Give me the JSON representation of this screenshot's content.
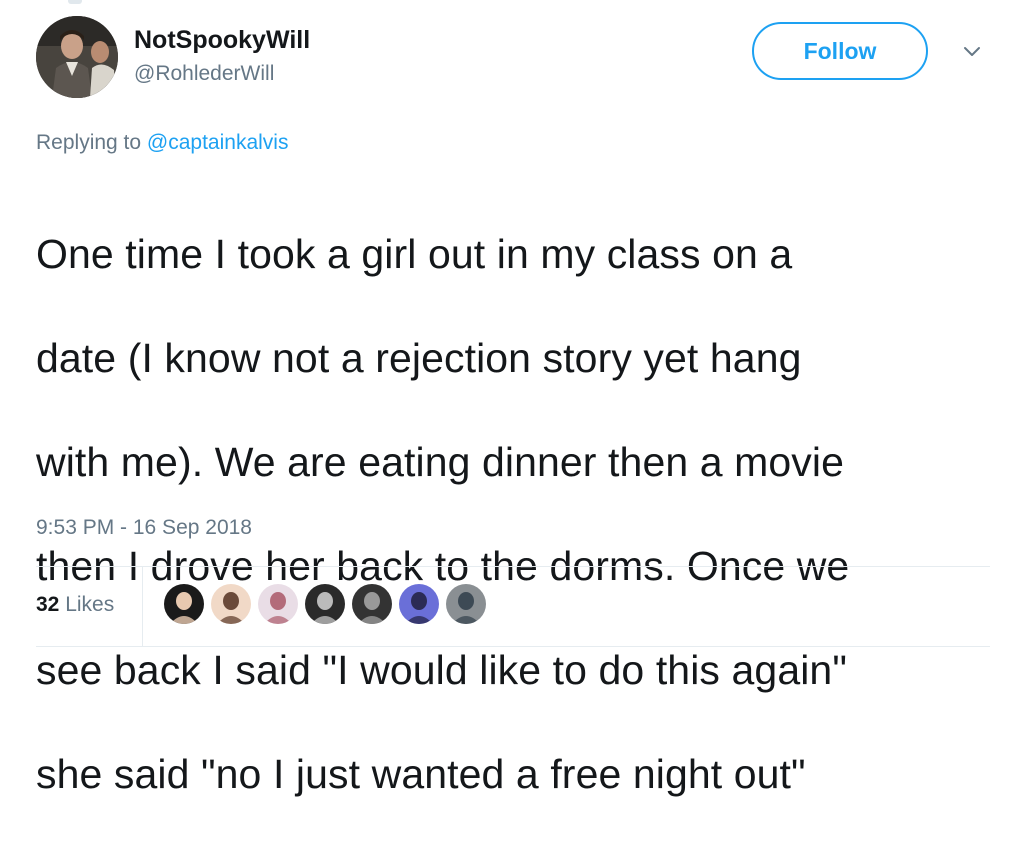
{
  "tweet": {
    "display_name": "NotSpookyWill",
    "handle": "@RohlederWill",
    "follow_label": "Follow",
    "replying_prefix": "Replying to",
    "replying_to": "@captainkalvis",
    "text_lines": [
      "One time I took a girl out in my class on a",
      "date (I know not a rejection story yet hang",
      "with me). We are eating dinner then a movie",
      "then I drove her back to the dorms. Once we",
      "see back I said \"I would like to do this again\"",
      "she said \"no I just wanted a free night out\""
    ],
    "timestamp": "9:53 PM - 16 Sep 2018",
    "likes_count": "32",
    "likes_label": "Likes"
  },
  "colors": {
    "accent": "#1da1f2",
    "secondary_text": "#657786",
    "primary_text": "#14171a",
    "divider": "#e6ecf0"
  },
  "icons": {
    "menu": "chevron-down-icon"
  },
  "likers": [
    {
      "name": "liker-avatar-1",
      "bg": "#1a1a1a",
      "fg": "#e8c9b0"
    },
    {
      "name": "liker-avatar-2",
      "bg": "#f1d9c7",
      "fg": "#6b4a3a"
    },
    {
      "name": "liker-avatar-3",
      "bg": "#e9dde6",
      "fg": "#b36b7a"
    },
    {
      "name": "liker-avatar-4",
      "bg": "#2a2a2a",
      "fg": "#bbbbbb"
    },
    {
      "name": "liker-avatar-5",
      "bg": "#333333",
      "fg": "#999999"
    },
    {
      "name": "liker-avatar-6",
      "bg": "#6a6fd8",
      "fg": "#2b2b55"
    },
    {
      "name": "liker-avatar-7",
      "bg": "#8a8f93",
      "fg": "#3d4a55"
    }
  ]
}
